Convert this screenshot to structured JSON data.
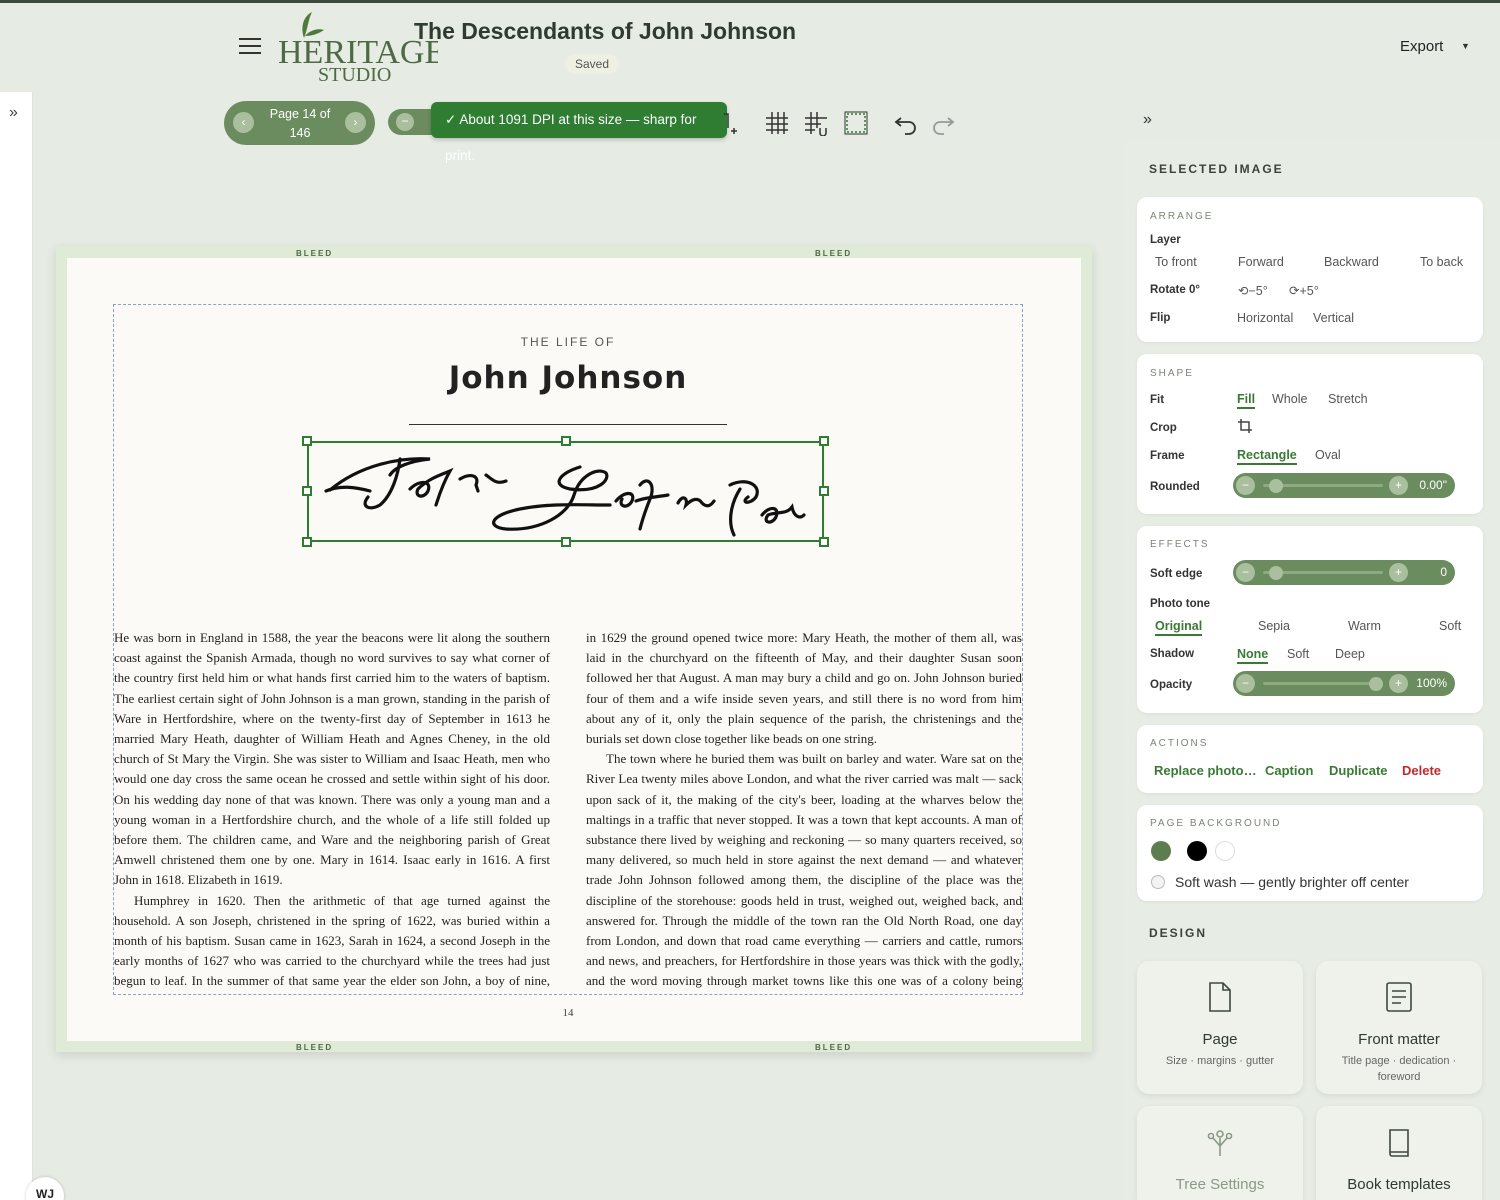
{
  "header": {
    "doc_title": "The Descendants of John Johnson",
    "saved": "Saved",
    "export": "Export",
    "logo_line1": "HERITAGE",
    "logo_line2": "STUDIO"
  },
  "toolbar": {
    "page_label": "Page 14 of 146",
    "toast": "✓ About 1091 DPI at this size — sharp for print."
  },
  "page": {
    "bleed": "BLEED",
    "subtitle": "THE LIFE OF",
    "heading": "John Johnson",
    "page_number": "14",
    "col1_p1": "He was born in England in 1588, the year the beacons were lit along the southern coast against the Spanish Armada, though no word survives to say what corner of the country first held him or what hands first carried him to the waters of baptism. The earliest certain sight of John Johnson is a man grown, standing in the parish of Ware in Hertfordshire, where on the twenty-first day of September in 1613 he married Mary Heath, daughter of William Heath and Agnes Cheney, in the old church of St Mary the Virgin. She was sister to William and Isaac Heath, men who would one day cross the same ocean he crossed and settle within sight of his door. On his wedding day none of that was known. There was only a young man and a young woman in a Hertfordshire church, and the whole of a life still folded up before them. The children came, and Ware and the neighboring parish of Great Amwell christened them one by one. Mary in 1614. Isaac early in 1616. A first John in 1618. Elizabeth in 1619.",
    "col1_p2": "Humphrey in 1620. Then the arithmetic of that age turned against the household. A son Joseph, christened in the spring of 1622, was buried within a month of his baptism. Susan came in 1623, Sarah in 1624, a second Joseph in the early months of 1627 who was carried to the churchyard while the trees had just begun to leaf. In the summer of that same year the elder son John, a boy of nine, was",
    "col2_p1": "in 1629 the ground opened twice more: Mary Heath, the mother of them all, was laid in the churchyard on the fifteenth of May, and their daughter Susan soon followed her that August. A man may bury a child and go on. John Johnson buried four of them and a wife inside seven years, and still there is no word from him about any of it, only the plain sequence of the parish, the christenings and the burials set down close together like beads on one string.",
    "col2_p2": "The town where he buried them was built on barley and water. Ware sat on the River Lea twenty miles above London, and what the river carried was malt — sack upon sack of it, the making of the city's beer, loading at the wharves below the maltings in a traffic that never stopped. It was a town that kept accounts. A man of substance there lived by weighing and reckoning — so many quarters received, so many delivered, so much held in store against the next demand — and whatever trade John Johnson followed among them, the discipline of the place was the discipline of the storehouse: goods held in trust, weighed out, weighed back, and answered for. Through the middle of the town ran the Old North Road, one day from London, and down that road came everything — carriers and cattle, rumors and news, and preachers, for Hertfordshire in those years was thick with the godly, and the word moving through market towns like this one was of a colony being gathered for New"
  },
  "panel": {
    "selected_title": "SELECTED IMAGE",
    "arrange": {
      "title": "ARRANGE",
      "layer_label": "Layer",
      "layer_options": [
        "To front",
        "Forward",
        "Backward",
        "To back"
      ],
      "rotate_label": "Rotate 0°",
      "rotate_left": "−5°",
      "rotate_right": "+5°",
      "flip_label": "Flip",
      "flip_options": [
        "Horizontal",
        "Vertical"
      ]
    },
    "shape": {
      "title": "SHAPE",
      "fit_label": "Fit",
      "fit_options": [
        "Fill",
        "Whole",
        "Stretch"
      ],
      "crop_label": "Crop",
      "frame_label": "Frame",
      "frame_options": [
        "Rectangle",
        "Oval"
      ],
      "rounded_label": "Rounded",
      "rounded_value": "0.00\"",
      "rounded_level": 0
    },
    "effects": {
      "title": "EFFECTS",
      "soft_edge_label": "Soft edge",
      "soft_edge_value": "0",
      "soft_edge_level": 0,
      "photo_tone_label": "Photo tone",
      "tone_options": [
        "Original",
        "Sepia",
        "Warm",
        "Soft"
      ],
      "shadow_label": "Shadow",
      "shadow_options": [
        "None",
        "Soft",
        "Deep"
      ],
      "opacity_label": "Opacity",
      "opacity_value": "100%",
      "opacity_level": 1
    },
    "actions": {
      "title": "ACTIONS",
      "replace": "Replace photo…",
      "caption": "Caption",
      "duplicate": "Duplicate",
      "delete": "Delete"
    },
    "background": {
      "title": "PAGE BACKGROUND",
      "swatches": [
        "#5d7d4f",
        "#000000",
        "#ffffff"
      ],
      "soft_wash": "Soft wash — gently brighter off center"
    },
    "design": {
      "title": "DESIGN",
      "cards": [
        {
          "title": "Page",
          "sub": "Size · margins · gutter",
          "icon": "page-icon"
        },
        {
          "title": "Front matter",
          "sub": "Title page · dedication · foreword",
          "icon": "document-icon"
        },
        {
          "title": "Tree Settings",
          "sub": "",
          "icon": "tree-icon"
        },
        {
          "title": "Book templates",
          "sub": "",
          "icon": "book-icon"
        }
      ]
    }
  },
  "user": {
    "initials": "WJ"
  },
  "colors": {
    "accent": "#6b8c5f",
    "selection": "#2e7d32",
    "danger": "#c62828"
  }
}
